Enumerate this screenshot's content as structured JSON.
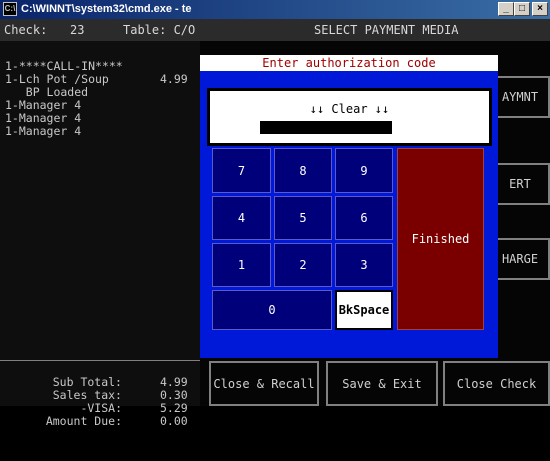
{
  "window": {
    "title": "C:\\WINNT\\system32\\cmd.exe - te",
    "minimize": "_",
    "maximize": "□",
    "close": "×"
  },
  "header": {
    "check_label": "Check:",
    "check_number": "23",
    "table": "Table: C/O",
    "screen_title": "SELECT PAYMENT MEDIA"
  },
  "order": {
    "items": [
      {
        "text": "1-****CALL-IN****",
        "price": ""
      },
      {
        "text": "1-Lch Pot /Soup",
        "price": "4.99"
      },
      {
        "text": "   BP Loaded",
        "price": ""
      },
      {
        "text": "1-Manager 4",
        "price": ""
      },
      {
        "text": "1-Manager 4",
        "price": ""
      },
      {
        "text": "1-Manager 4",
        "price": ""
      }
    ],
    "totals": [
      {
        "label": "Sub Total:",
        "value": "4.99"
      },
      {
        "label": "Sales tax:",
        "value": "0.30"
      },
      {
        "label": "-VISA:",
        "value": "5.29"
      },
      {
        "label": "Amount Due:",
        "value": "0.00"
      }
    ]
  },
  "side_buttons": [
    "AYMNT",
    "ERT",
    "HARGE"
  ],
  "bottom_buttons": [
    "Close & Recall",
    "Save & Exit",
    "Close Check"
  ],
  "dialog": {
    "title": "Enter authorization code",
    "entry_label": "↓↓ Clear ↓↓",
    "keys": [
      "7",
      "8",
      "9",
      "4",
      "5",
      "6",
      "1",
      "2",
      "3",
      "0"
    ],
    "finished": "Finished",
    "backspace": "BkSpace"
  }
}
